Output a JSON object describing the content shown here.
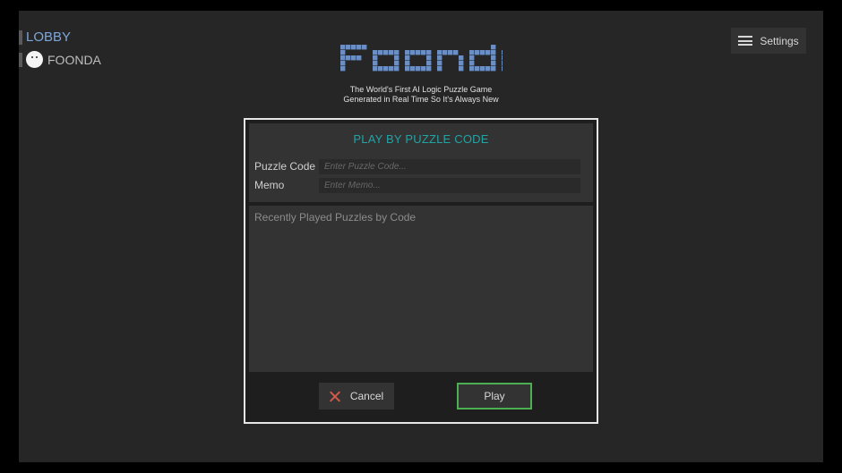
{
  "nav": {
    "lobby_label": "LOBBY",
    "profile_label": "FOONDA"
  },
  "settings": {
    "label": "Settings"
  },
  "logo": {
    "text": "Foonda",
    "color": "#6b8fc4"
  },
  "tagline": {
    "line1": "The World's First AI Logic Puzzle Game",
    "line2": "Generated in Real Time So It's Always New"
  },
  "dialog": {
    "title": "PLAY BY PUZZLE CODE",
    "puzzle_code_label": "Puzzle Code",
    "puzzle_code_placeholder": "Enter Puzzle Code...",
    "puzzle_code_value": "",
    "memo_label": "Memo",
    "memo_placeholder": "Enter Memo...",
    "memo_value": "",
    "recent_header": "Recently Played Puzzles by Code",
    "cancel_label": "Cancel",
    "play_label": "Play"
  },
  "colors": {
    "title_accent": "#23a3a3",
    "play_border": "#4caf50",
    "cancel_icon": "#d25a4a",
    "lobby_link": "#7ea6d8"
  }
}
